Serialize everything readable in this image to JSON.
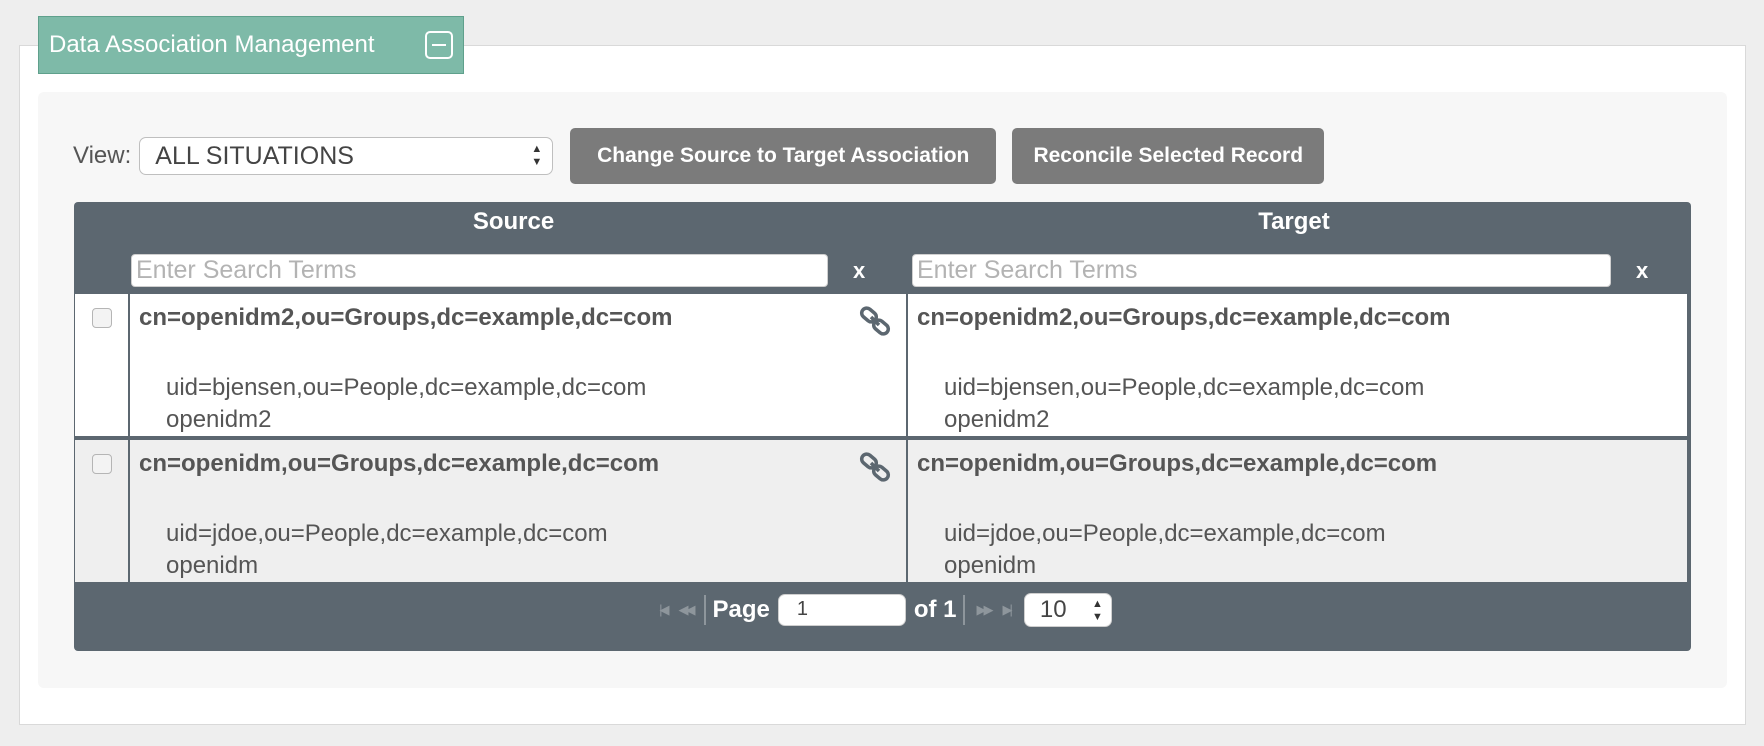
{
  "panel": {
    "title": "Data Association Management"
  },
  "toolbar": {
    "view_label": "View:",
    "view_selected": "ALL SITUATIONS",
    "change_button": "Change Source to Target Association",
    "reconcile_button": "Reconcile Selected Record"
  },
  "grid": {
    "source_header": "Source",
    "target_header": "Target",
    "search_placeholder": "Enter Search Terms",
    "clear_label": "x",
    "rows": [
      {
        "source_dn": "cn=openidm2,ou=Groups,dc=example,dc=com",
        "source_member": "uid=bjensen,ou=People,dc=example,dc=com",
        "source_cn": "openidm2",
        "target_dn": "cn=openidm2,ou=Groups,dc=example,dc=com",
        "target_member": "uid=bjensen,ou=People,dc=example,dc=com",
        "target_cn": "openidm2"
      },
      {
        "source_dn": "cn=openidm,ou=Groups,dc=example,dc=com",
        "source_member": "uid=jdoe,ou=People,dc=example,dc=com",
        "source_cn": "openidm",
        "target_dn": "cn=openidm,ou=Groups,dc=example,dc=com",
        "target_member": "uid=jdoe,ou=People,dc=example,dc=com",
        "target_cn": "openidm"
      }
    ]
  },
  "pager": {
    "page_label": "Page",
    "current_page": "1",
    "of_label": "of 1",
    "page_size": "10"
  },
  "icons": {
    "collapse": "minus-square-icon",
    "link": "link-icon",
    "first": "first-page-icon",
    "prev": "prev-page-icon",
    "next": "next-page-icon",
    "last": "last-page-icon"
  },
  "colors": {
    "header_bg": "#7ebaa8",
    "grid_bg": "#5c6770",
    "button_bg": "#7b7b7b"
  }
}
